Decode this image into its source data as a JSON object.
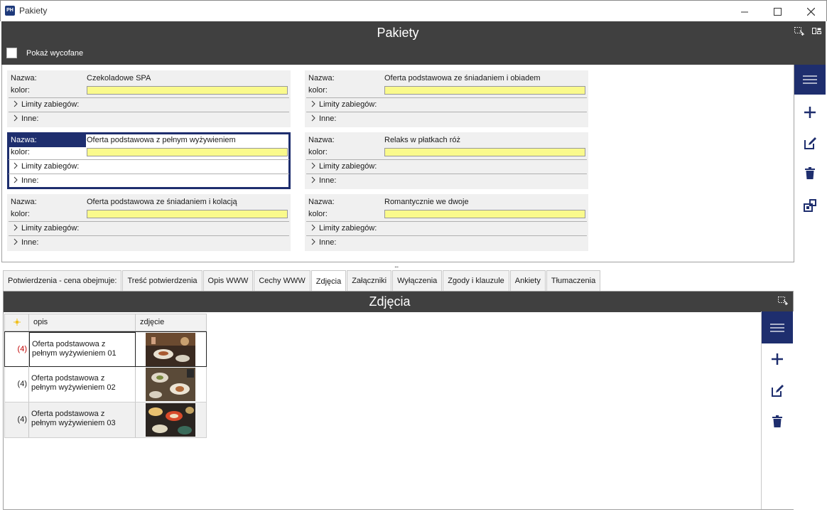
{
  "window": {
    "title": "Pakiety",
    "app_icon_text": "PH"
  },
  "header": {
    "title": "Pakiety",
    "show_withdrawn_label": "Pokaż wycofane"
  },
  "card_labels": {
    "name": "Nazwa:",
    "color": "kolor:",
    "limits": "Limity zabiegów:",
    "other": "Inne:"
  },
  "packages": [
    {
      "name": "Czekoladowe SPA",
      "color": "#fafa8c",
      "selected": false
    },
    {
      "name": "Oferta podstawowa ze śniadaniem i obiadem",
      "color": "#fafa8c",
      "selected": false
    },
    {
      "name": "Oferta podstawowa z pełnym wyżywieniem",
      "color": "#fafa8c",
      "selected": true
    },
    {
      "name": "Relaks w płatkach róż",
      "color": "#fafa8c",
      "selected": false
    },
    {
      "name": "Oferta podstawowa ze śniadaniem i kolacją",
      "color": "#fafa8c",
      "selected": false
    },
    {
      "name": "Romantycznie we dwoje",
      "color": "#fafa8c",
      "selected": false
    }
  ],
  "splitter_text": "...",
  "tabs": [
    {
      "label": "Potwierdzenia - cena obejmuje:",
      "active": false
    },
    {
      "label": "Treść potwierdzenia",
      "active": false
    },
    {
      "label": "Opis WWW",
      "active": false
    },
    {
      "label": "Cechy WWW",
      "active": false
    },
    {
      "label": "Zdjęcia",
      "active": true
    },
    {
      "label": "Załączniki",
      "active": false
    },
    {
      "label": "Wyłączenia",
      "active": false
    },
    {
      "label": "Zgody i klauzule",
      "active": false
    },
    {
      "label": "Ankiety",
      "active": false
    },
    {
      "label": "Tłumaczenia",
      "active": false
    }
  ],
  "photos": {
    "title": "Zdjęcia",
    "columns": [
      "opis",
      "zdjęcie"
    ],
    "rows": [
      {
        "num": "(4)",
        "desc_line1": "Oferta podstawowa z",
        "desc_line2": "pełnym wyżywieniem 01",
        "selected": true
      },
      {
        "num": "(4)",
        "desc_line1": "Oferta podstawowa z",
        "desc_line2": "pełnym wyżywieniem 02",
        "selected": false
      },
      {
        "num": "(4)",
        "desc_line1": "Oferta podstawowa z",
        "desc_line2": "pełnym wyżywieniem 03",
        "selected": false
      }
    ]
  },
  "colors": {
    "accent": "#1e2e6e",
    "header_bg": "#404040",
    "color_field": "#fafa8c",
    "selected_num": "#c00000"
  },
  "icons": [
    "menu-icon",
    "add-icon",
    "edit-icon",
    "delete-icon",
    "export-icon",
    "selection-icon",
    "layout-icon",
    "sun-icon"
  ]
}
